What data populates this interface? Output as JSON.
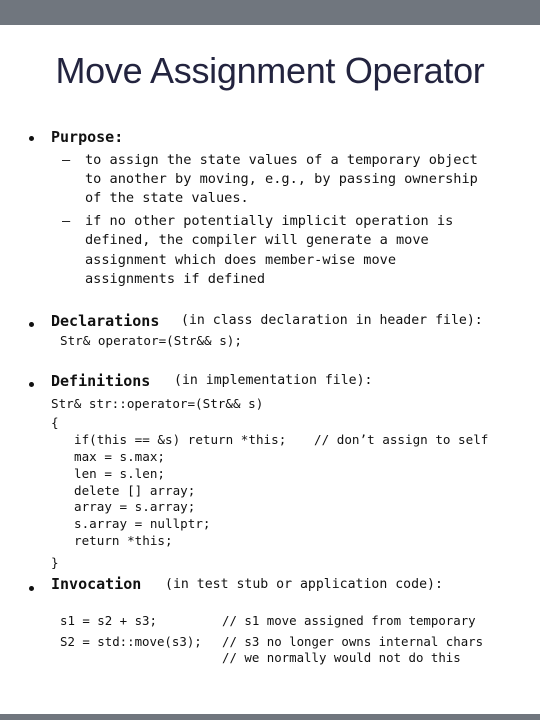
{
  "slide": {
    "title": "Move Assignment Operator",
    "bar_color": "#70767e",
    "title_color": "#23243f"
  },
  "purpose": {
    "heading": "Purpose:",
    "items": [
      {
        "dash": "–",
        "lines": [
          "to assign the state values of a temporary object",
          "to another by moving, e.g., by passing ownership",
          "of the state values."
        ]
      },
      {
        "dash": "–",
        "lines": [
          "if no other potentially implicit operation is",
          "defined, the compiler will generate a move",
          "assignment which does member-wise move",
          "assignments if defined"
        ]
      }
    ]
  },
  "declarations": {
    "heading": "Declarations",
    "note": "(in class declaration in header file):",
    "code": "Str& operator=(Str&& s);"
  },
  "definitions": {
    "heading": "Definitions",
    "note": "(in implementation file):",
    "signature": "Str& str::operator=(Str&& s)",
    "open_brace": "{",
    "body": [
      "if(this == &s) return *this;",
      "max = s.max;",
      "len = s.len;",
      "delete [] array;",
      "array = s.array;",
      "s.array = nullptr;",
      "return *this;"
    ],
    "self_comment": "// don’t assign to self",
    "close_brace": "}"
  },
  "invocation": {
    "heading": "Invocation",
    "note": "(in test stub or application code):",
    "lines": [
      {
        "code": "s1 = s2 + s3;",
        "comment": "// s1 move assigned from temporary"
      },
      {
        "code": "S2 = std::move(s3);",
        "comment": "// s3 no longer owns internal chars"
      },
      {
        "code": "",
        "comment": "// we normally would not do this"
      }
    ]
  }
}
